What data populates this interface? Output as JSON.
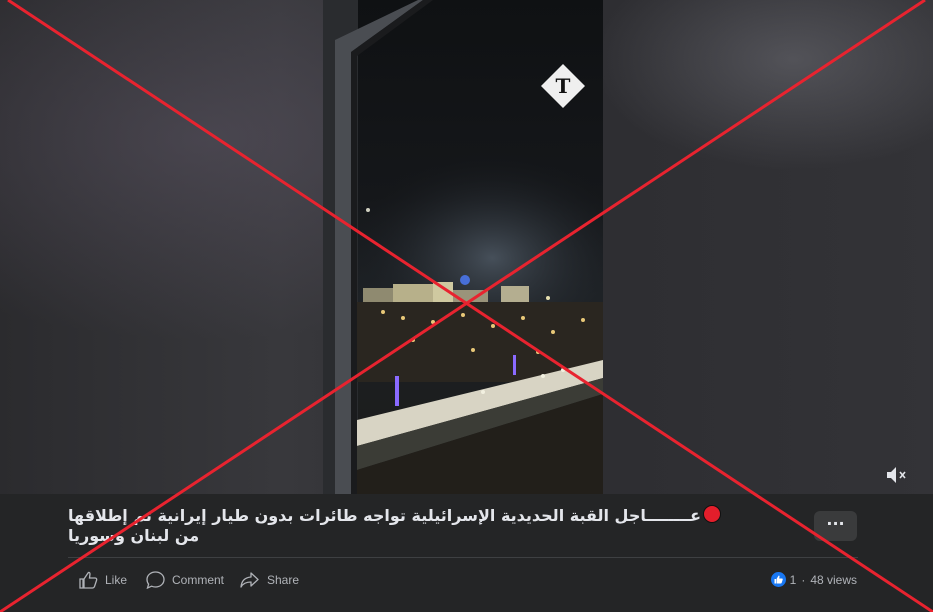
{
  "video": {
    "publisher_logo": "T",
    "mute_icon": "speaker-muted-icon"
  },
  "post": {
    "title": "عــــــــاجل القبة الحديدية الإسرائيلية تواجه طائرات بدون طيار إيرانية تم إطلاقها من لبنان وسوريا",
    "more_label": "···"
  },
  "actions": {
    "like": "Like",
    "comment": "Comment",
    "share": "Share"
  },
  "stats": {
    "reaction_count": "1",
    "views": "48 views"
  },
  "colors": {
    "overlay_x": "#e8232f",
    "reaction_blue": "#1877f2",
    "dot_red": "#e41e2b"
  }
}
